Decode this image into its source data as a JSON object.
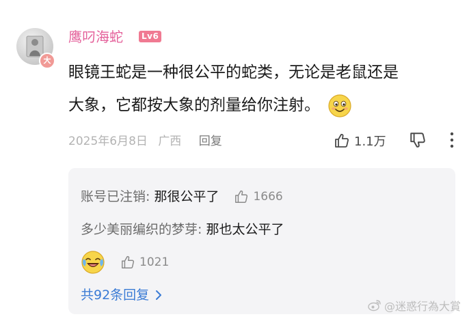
{
  "comment": {
    "username": "鹰叼海蛇",
    "level": "Lv6",
    "avatar_badge": "大",
    "text_line1": "眼镜王蛇是一种很公平的蛇类，无论是老鼠还是",
    "text_line2": "大象，它都按大象的剂量给你注射。",
    "emoji": "smile-emoji",
    "date": "2025年6月8日",
    "region": "广西",
    "reply_label": "回复",
    "like_count": "1.1万"
  },
  "replies": {
    "items": [
      {
        "name": "账号已注销",
        "separator": ": ",
        "text": "那很公平了",
        "likes": "1666"
      },
      {
        "name": "多少美丽编织的梦芽",
        "separator": ": ",
        "text": "那也太公平了",
        "emoji": "laughing-crying-emoji",
        "likes": "1021"
      }
    ],
    "more_label": "共92条回复"
  },
  "watermark": {
    "text": "@迷惑行為大賞"
  },
  "colors": {
    "username": "#e4609a",
    "level_badge": "#f07a92",
    "link_blue": "#3a7bd5",
    "panel_bg": "#f4f4f6"
  }
}
